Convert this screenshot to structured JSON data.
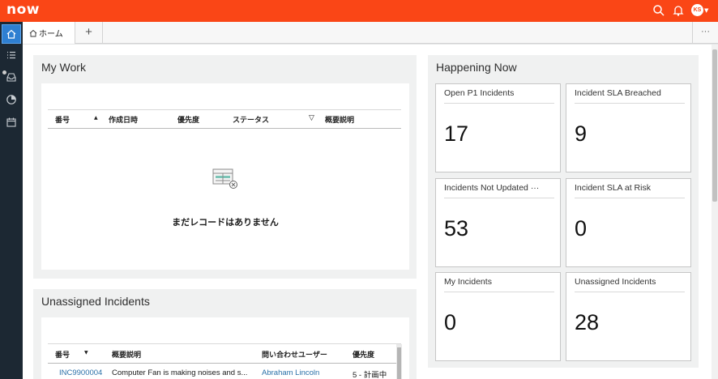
{
  "header": {
    "logo": "now",
    "avatar_initials": "KS"
  },
  "tabs": {
    "home_label": "ホーム",
    "add_label": "+",
    "more_label": "···"
  },
  "my_work": {
    "title": "My Work",
    "columns": [
      "番号",
      "作成日時",
      "優先度",
      "ステータス",
      "概要説明"
    ],
    "empty_message": "まだレコードはありません"
  },
  "unassigned": {
    "title": "Unassigned Incidents",
    "columns": [
      "番号",
      "概要説明",
      "問い合わせユーザー",
      "優先度"
    ],
    "rows": [
      {
        "number": "INC9900004",
        "description": "Computer Fan is making noises and s...",
        "caller": "Abraham Lincoln",
        "priority": "5 - 計画中"
      }
    ]
  },
  "happening_now": {
    "title": "Happening Now",
    "cards": [
      {
        "title": "Open P1 Incidents",
        "value": "17"
      },
      {
        "title": "Incident SLA Breached",
        "value": "9"
      },
      {
        "title": "Incidents Not Updated ···",
        "value": "53"
      },
      {
        "title": "Incident SLA at Risk",
        "value": "0"
      },
      {
        "title": "My Incidents",
        "value": "0"
      },
      {
        "title": "Unassigned Incidents",
        "value": "28"
      }
    ]
  },
  "colors": {
    "brand": "#fa4616",
    "nav": "#1c2833",
    "active_nav": "#2e7fd1",
    "link": "#2a71a8"
  }
}
